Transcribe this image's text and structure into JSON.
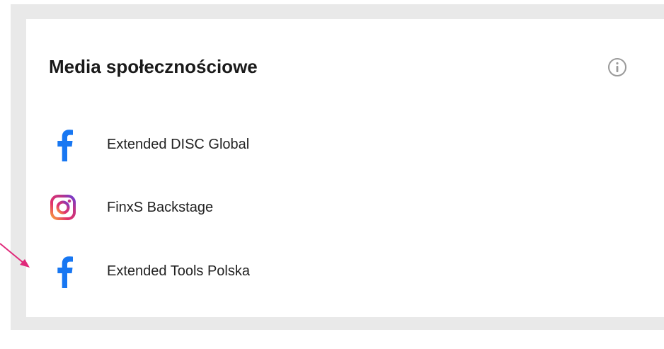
{
  "panel": {
    "title": "Media społecznościowe",
    "info_icon": "info-icon"
  },
  "social_links": [
    {
      "platform": "facebook",
      "icon": "facebook-icon",
      "label": "Extended DISC Global"
    },
    {
      "platform": "instagram",
      "icon": "instagram-icon",
      "label": "FinxS Backstage"
    },
    {
      "platform": "facebook",
      "icon": "facebook-icon",
      "label": "Extended Tools Polska"
    }
  ],
  "colors": {
    "facebook_blue": "#1877f2",
    "annotation_arrow": "#e0297a",
    "frame_gray": "#e9e9e9",
    "info_icon_gray": "#9a9a9a"
  },
  "annotation": {
    "arrow_icon": "annotation-arrow"
  }
}
